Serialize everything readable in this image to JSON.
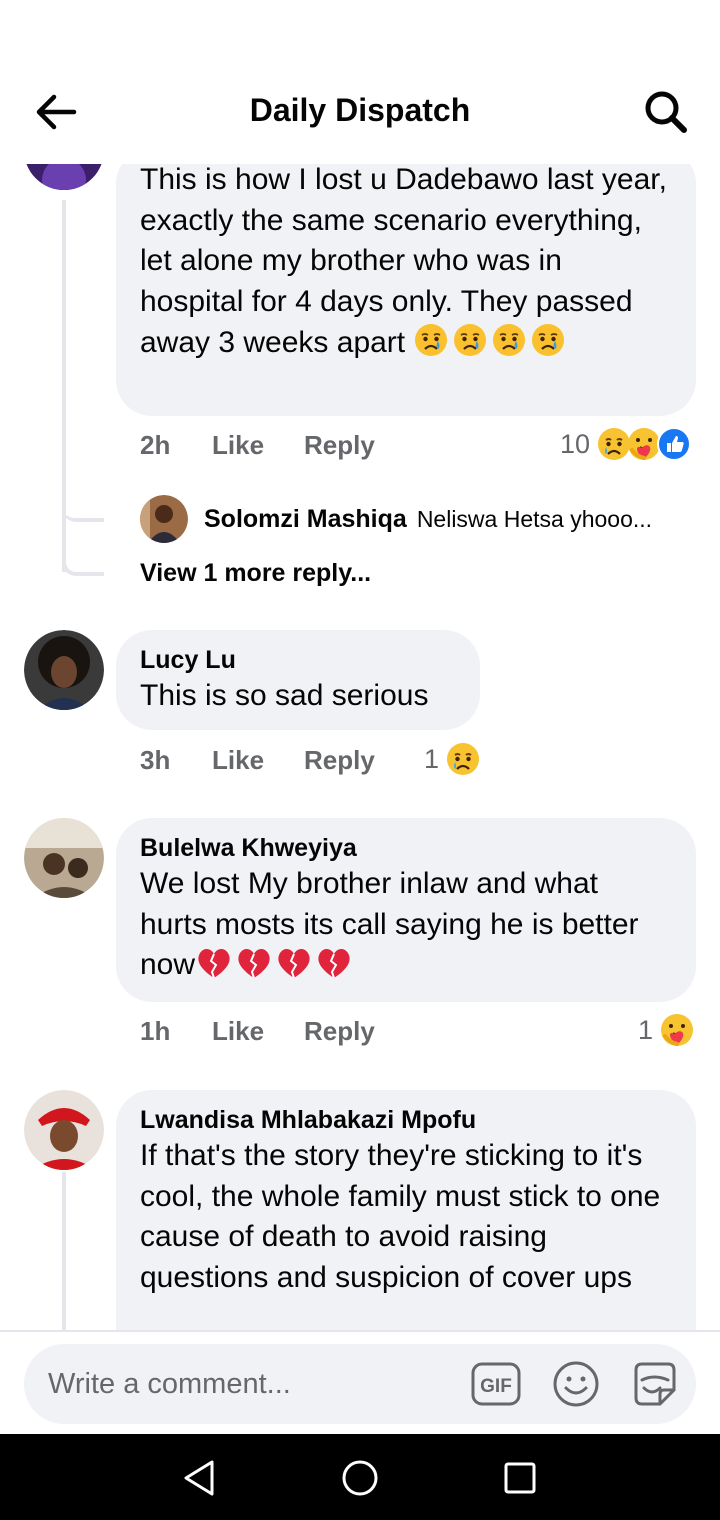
{
  "header": {
    "title": "Daily Dispatch",
    "back_icon": "arrow-left-icon",
    "search_icon": "search-icon"
  },
  "comments": [
    {
      "author": "",
      "text": "This is how I lost u Dadebawo last year, exactly the same  scenario everything, let alone my brother who was in hospital for 4 days only. They passed away 3 weeks apart",
      "trailing_emojis": [
        "crying-face",
        "crying-face",
        "crying-face",
        "crying-face"
      ],
      "time": "2h",
      "like_label": "Like",
      "reply_label": "Reply",
      "reaction_count": "10",
      "reactions": [
        "sad-reaction",
        "care-reaction",
        "like-reaction"
      ]
    },
    {
      "author": "Lucy Lu",
      "text": "This is so sad serious",
      "time": "3h",
      "like_label": "Like",
      "reply_label": "Reply",
      "reaction_count": "1",
      "reactions": [
        "sad-reaction"
      ]
    },
    {
      "author": "Bulelwa Khweyiya",
      "text": "We lost My brother inlaw and what hurts mosts its call saying he is better now",
      "trailing_emojis": [
        "broken-heart",
        "broken-heart",
        "broken-heart",
        "broken-heart"
      ],
      "time": "1h",
      "like_label": "Like",
      "reply_label": "Reply",
      "reaction_count": "1",
      "reactions": [
        "care-reaction"
      ]
    },
    {
      "author": "Lwandisa Mhlabakazi Mpofu",
      "text": "If that's the story they're sticking to it's cool, the whole family must stick to one cause of death to avoid raising questions and suspicion of cover ups"
    }
  ],
  "nested_reply": {
    "author": "Solomzi Mashiqa",
    "preview": "Neliswa Hetsa yhooo..."
  },
  "view_more_label": "View 1 more reply...",
  "composer": {
    "placeholder": "Write a comment...",
    "gif_label": "GIF"
  },
  "colors": {
    "bubble": "#f0f2f5",
    "secondary_text": "#65676b",
    "like_blue": "#1877f2",
    "thread_line": "#e4e6eb"
  }
}
